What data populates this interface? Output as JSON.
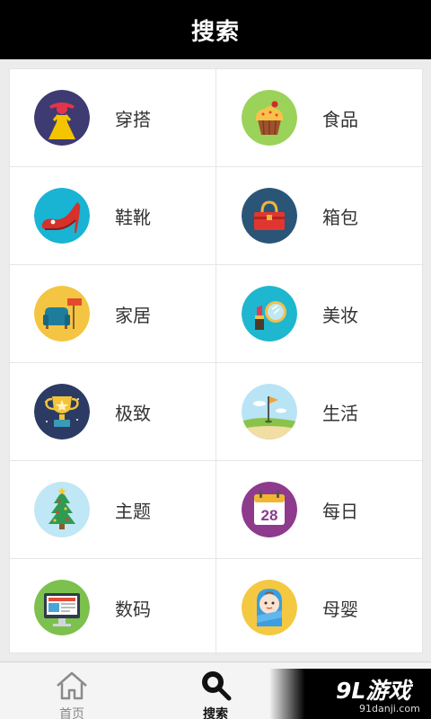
{
  "header": {
    "title": "搜索"
  },
  "categories": [
    {
      "label": "穿搭",
      "icon": "dress-icon"
    },
    {
      "label": "食品",
      "icon": "cupcake-icon"
    },
    {
      "label": "鞋靴",
      "icon": "high-heel-icon"
    },
    {
      "label": "箱包",
      "icon": "handbag-icon"
    },
    {
      "label": "家居",
      "icon": "armchair-icon"
    },
    {
      "label": "美妆",
      "icon": "lipstick-mirror-icon"
    },
    {
      "label": "极致",
      "icon": "trophy-icon"
    },
    {
      "label": "生活",
      "icon": "golf-flag-icon"
    },
    {
      "label": "主题",
      "icon": "christmas-tree-icon"
    },
    {
      "label": "每日",
      "icon": "calendar-icon",
      "calendar_day": "28"
    },
    {
      "label": "数码",
      "icon": "monitor-icon"
    },
    {
      "label": "母婴",
      "icon": "baby-icon"
    }
  ],
  "tabbar": {
    "home_label": "首页",
    "search_label": "搜索"
  },
  "watermark": {
    "logo": "9L游戏",
    "url": "91danji.com"
  },
  "colors": {
    "header_bg": "#000000",
    "tabbar_bg": "#f4f4f4"
  }
}
